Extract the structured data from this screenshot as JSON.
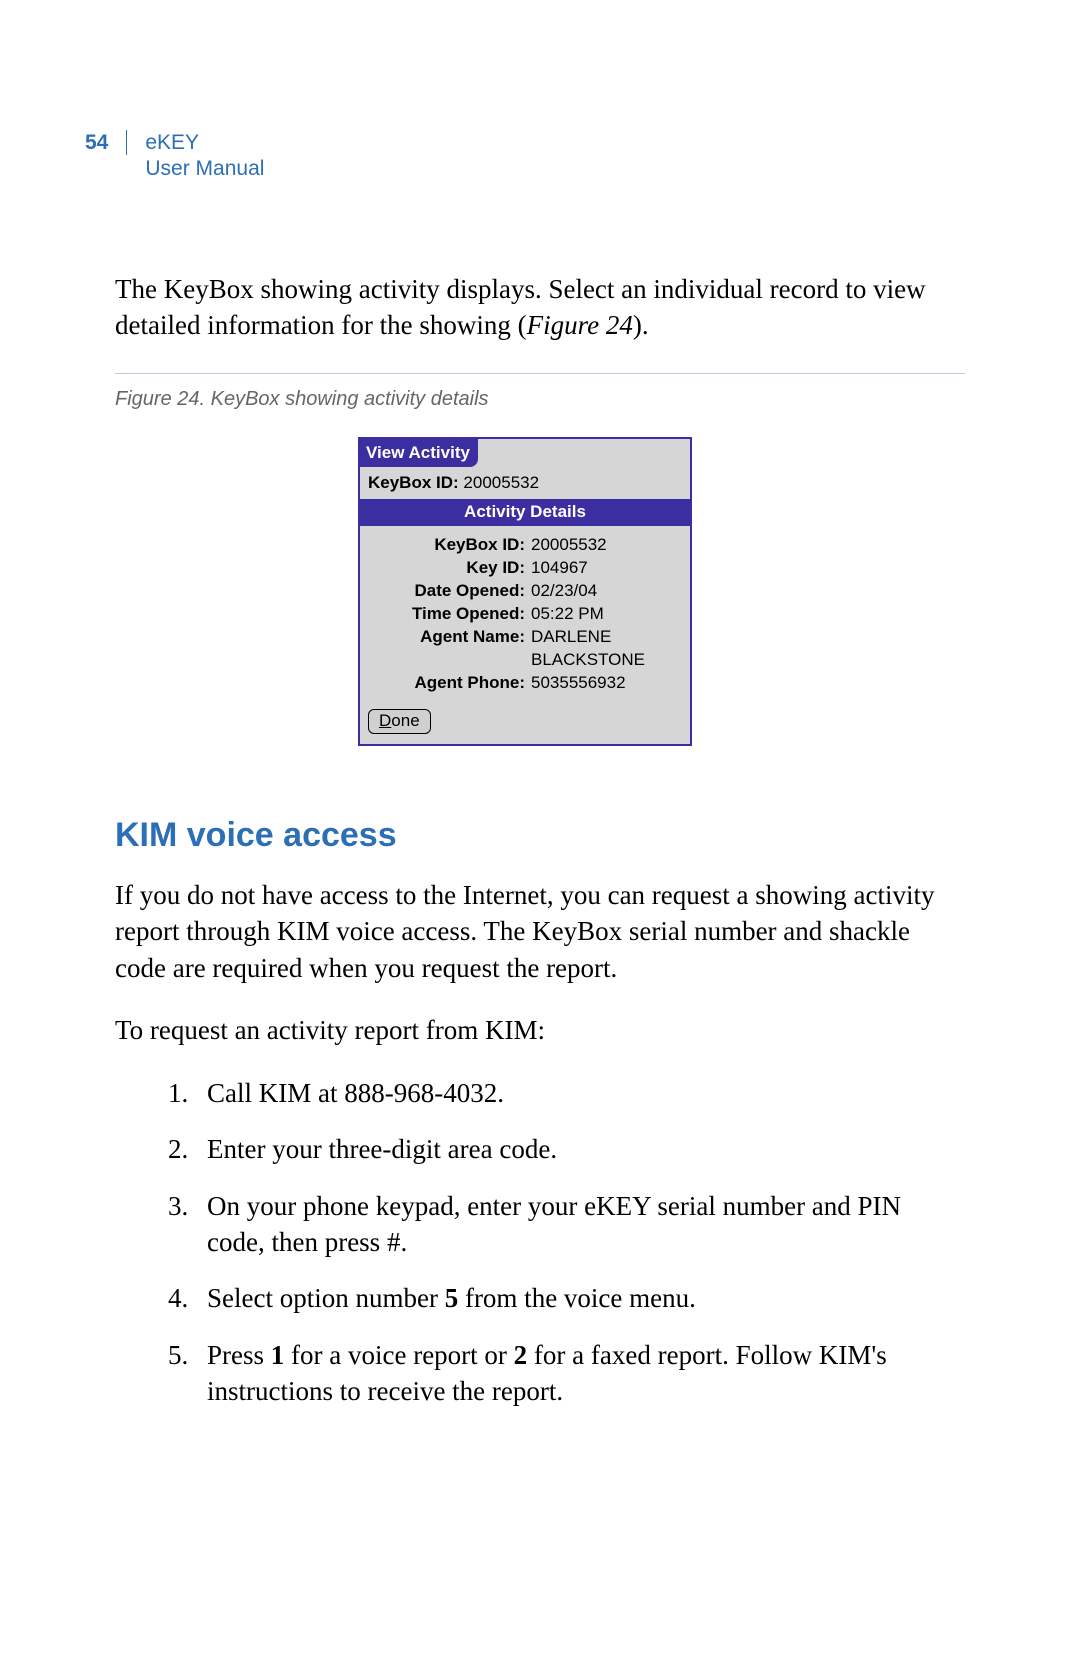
{
  "header": {
    "page_number": "54",
    "product": "eKEY",
    "doc_type": "User Manual"
  },
  "intro_para_pre": "The KeyBox showing activity displays.  Select an individual record to view detailed information for the showing (",
  "intro_para_fig": "Figure 24",
  "intro_para_post": ").",
  "figure_caption": "Figure 24.  KeyBox showing activity details",
  "palm": {
    "title_tab": "View Activity",
    "top_label": "KeyBox ID:",
    "top_value": "20005532",
    "section_header": "Activity Details",
    "rows": [
      {
        "label": "KeyBox ID:",
        "value": "20005532"
      },
      {
        "label": "Key ID:",
        "value": "104967"
      },
      {
        "label": "Date Opened:",
        "value": "02/23/04"
      },
      {
        "label": "Time Opened:",
        "value": "05:22 PM"
      },
      {
        "label": "Agent Name:",
        "value": "DARLENE"
      },
      {
        "label": "",
        "value": "BLACKSTONE",
        "cont": true
      },
      {
        "label": "Agent Phone:",
        "value": "5035556932"
      }
    ],
    "done_button_u": "D",
    "done_button_rest": "one"
  },
  "section_title": "KIM voice access",
  "kim_para": "If you do not have access to the Internet, you can request a showing activity report through KIM voice access.  The KeyBox serial number and shackle code are required when you request the report.",
  "kim_lead": "To request an activity report from KIM:",
  "steps": {
    "s1": "Call KIM at 888-968-4032.",
    "s2": "Enter your three-digit area code.",
    "s3": "On your phone keypad, enter your eKEY serial number and PIN code, then press #.",
    "s4_pre": "Select option number ",
    "s4_bold": "5",
    "s4_post": " from the voice menu.",
    "s5_a": "Press ",
    "s5_b1": "1",
    "s5_b": " for a voice report or ",
    "s5_b2": "2",
    "s5_c": " for a faxed report.  Follow KIM's instructions to receive the report."
  }
}
